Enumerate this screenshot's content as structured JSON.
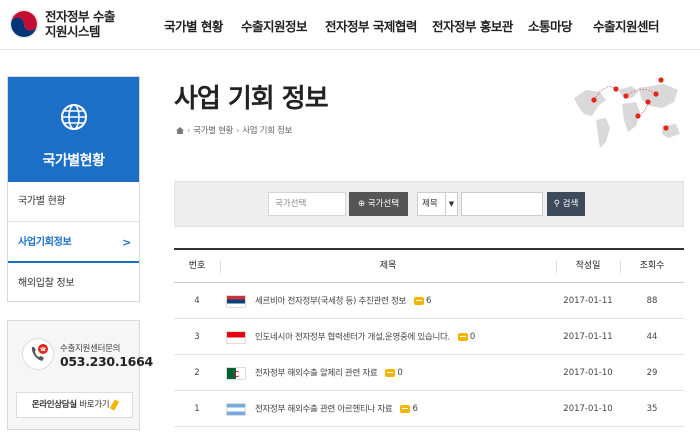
{
  "header": {
    "logo_line1": "전자정부 수출",
    "logo_line2": "지원시스템",
    "nav": [
      "국가별 현황",
      "수출지원정보",
      "전자정부 국제협력",
      "전자정부 홍보관",
      "소통마당",
      "수출지원센터"
    ]
  },
  "sidebar": {
    "title": "국가별현황",
    "items": [
      {
        "label": "국가별 현황",
        "active": false
      },
      {
        "label": "사업기회정보",
        "active": true,
        "arrow": ">"
      },
      {
        "label": "해외입찰 정보",
        "active": false
      }
    ],
    "contact": {
      "label": "수출지원센터문의",
      "phone": "053.230.1664",
      "consult_bold": "온라인상담실",
      "consult_rest": " 바로가기"
    }
  },
  "page": {
    "title": "사업 기회 정보",
    "breadcrumb": [
      "국가별 현황",
      "사업 기회 정보"
    ]
  },
  "search": {
    "country_placeholder": "국가선택",
    "country_button": "국가선택",
    "type_value": "제목",
    "search_button": "검색"
  },
  "board": {
    "headers": {
      "no": "번호",
      "title": "제목",
      "date": "작성일",
      "views": "조회수"
    },
    "rows": [
      {
        "no": "4",
        "flag": "serbia",
        "title": "세르비아 전자정부(국세청 등) 추진관련 정보",
        "comments": "6",
        "date": "2017-01-11",
        "views": "88"
      },
      {
        "no": "3",
        "flag": "indonesia",
        "title": "인도네시아 전자정부 협력센터가 개설,운영중에 있습니다.",
        "comments": "0",
        "date": "2017-01-11",
        "views": "44"
      },
      {
        "no": "2",
        "flag": "algeria",
        "title": "전자정부 해외수출 알제리 관련 자료",
        "comments": "0",
        "date": "2017-01-10",
        "views": "29"
      },
      {
        "no": "1",
        "flag": "argentina",
        "title": "전자정부 해외수출 관련 아르헨티나 자료",
        "comments": "6",
        "date": "2017-01-10",
        "views": "35"
      }
    ]
  },
  "colors": {
    "brand_blue": "#1b6fc7",
    "comment_yellow": "#f2b600",
    "search_dark": "#3d4a5c"
  }
}
